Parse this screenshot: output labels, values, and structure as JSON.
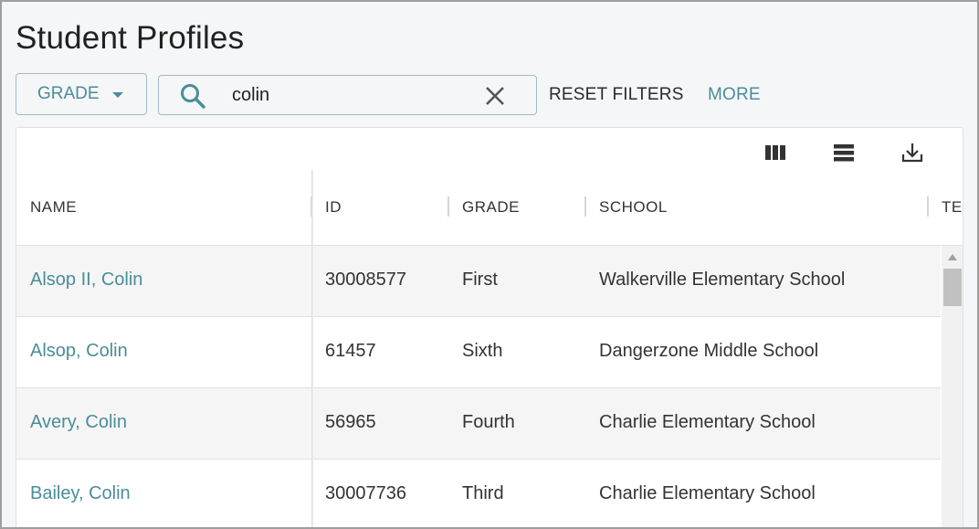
{
  "page_title": "Student Profiles",
  "filters": {
    "grade_label": "GRADE",
    "search_value": "colin",
    "reset_label": "RESET FILTERS",
    "more_label": "MORE"
  },
  "toolbar": {
    "icons": [
      "columns-icon",
      "density-icon",
      "download-icon"
    ]
  },
  "table": {
    "columns": [
      "NAME",
      "ID",
      "GRADE",
      "SCHOOL",
      "TEA"
    ],
    "rows": [
      {
        "name": "Alsop II, Colin",
        "id": "30008577",
        "grade": "First",
        "school": "Walkerville Elementary School"
      },
      {
        "name": "Alsop, Colin",
        "id": "61457",
        "grade": "Sixth",
        "school": "Dangerzone Middle School"
      },
      {
        "name": "Avery, Colin",
        "id": "56965",
        "grade": "Fourth",
        "school": "Charlie Elementary School"
      },
      {
        "name": "Bailey, Colin",
        "id": "30007736",
        "grade": "Third",
        "school": "Charlie Elementary School"
      }
    ]
  },
  "colors": {
    "accent": "#4a8d99",
    "border": "#9fbcc4",
    "row_alt": "#f5f5f5"
  }
}
